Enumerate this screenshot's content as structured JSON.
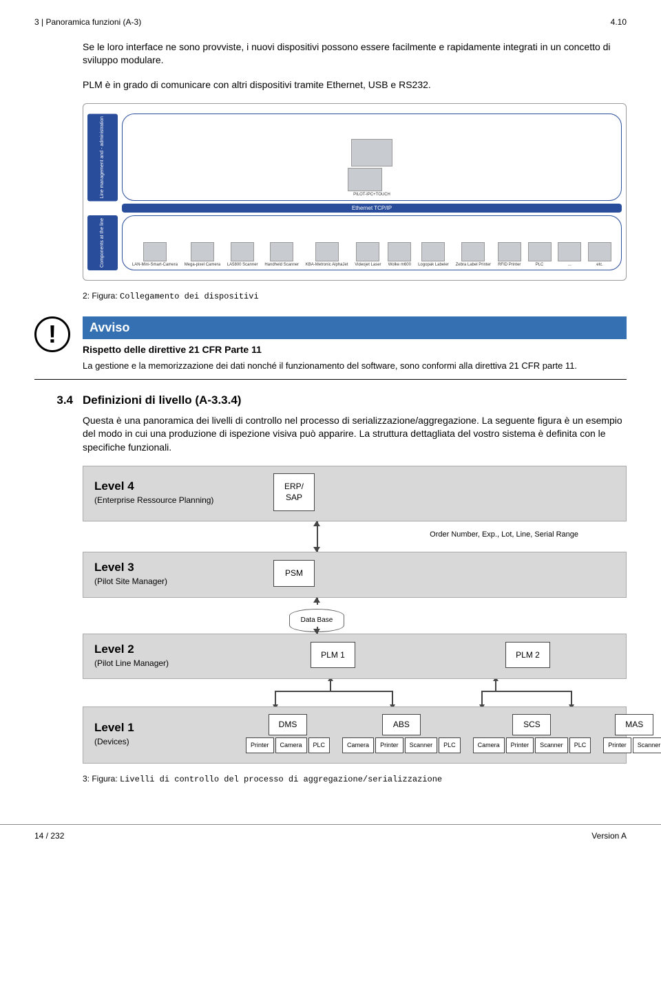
{
  "header": {
    "left": "3 | Panoramica funzioni (A-3)",
    "right": "4.10"
  },
  "intro": {
    "p1": "Se le loro interface ne sono provviste, i nuovi dispositivi possono essere facilmente e rapidamente integrati in un concetto di sviluppo modulare.",
    "p2": "PLM è in grado di comunicare con altri dispositivi tramite Ethernet, USB e RS232."
  },
  "fig1": {
    "side_labels": {
      "top": "Line management and - administration",
      "bottom": "Components at the line"
    },
    "top_item": "PILOT-IPC+TOUCH",
    "bus_label": "Ethernet TCP/IP",
    "items": [
      "LAN-Mini-Smart-Camera",
      "Mega-pixel Camera",
      "LA5800 Scanner",
      "Handheld Scanner",
      "KBA-Metronic AlphaJet",
      "Videojet Laser",
      "Wolke m600",
      "Logopak Labeler",
      "Zebra Label Printer",
      "RFID Printer",
      "PLC",
      "...",
      "etc."
    ],
    "caption_prefix": "2: Figura: ",
    "caption_mono": "Collegamento dei dispositivi"
  },
  "notice": {
    "title": "Avviso",
    "subtitle": "Rispetto delle direttive 21 CFR Parte 11",
    "text": "La gestione e la memorizzazione dei dati nonché il funzionamento del software, sono conformi alla direttiva 21 CFR parte 11."
  },
  "section": {
    "num": "3.4",
    "title": "Definizioni di livello (A-3.3.4)",
    "body": "Questa è una panoramica dei livelli di controllo nel processo di serializzazione/aggregazione. La seguente figura è un esempio del modo in cui una produzione di ispezione visiva può apparire. La struttura dettagliata del vostro sistema è definita con le specifiche funzionali."
  },
  "diagram": {
    "levels": [
      {
        "title": "Level 4",
        "sub": "(Enterprise Ressource Planning)",
        "boxes": [
          "ERP/\nSAP"
        ]
      },
      {
        "title": "Level 3",
        "sub": "(Pilot Site Manager)",
        "boxes": [
          "PSM"
        ]
      },
      {
        "title": "Level 2",
        "sub": "(Pilot Line Manager)",
        "boxes": [
          "PLM 1",
          "PLM 2"
        ]
      },
      {
        "title": "Level 1",
        "sub": "(Devices)"
      }
    ],
    "conn34_label": "Order Number, Exp., Lot, Line, Serial Range",
    "database_label": "Data Base",
    "devices": [
      {
        "main": "DMS",
        "subs": [
          "Printer",
          "Camera",
          "PLC"
        ]
      },
      {
        "main": "ABS",
        "subs": [
          "Camera",
          "Printer",
          "Scanner",
          "PLC"
        ]
      },
      {
        "main": "SCS",
        "subs": [
          "Camera",
          "Printer",
          "Scanner",
          "PLC"
        ]
      },
      {
        "main": "MAS",
        "subs": [
          "Printer",
          "Scanner"
        ]
      }
    ]
  },
  "fig2_caption": {
    "prefix": "3: Figura: ",
    "mono": "Livelli di controllo del processo di aggregazione/serializzazione"
  },
  "footer": {
    "left": "14 / 232",
    "right": "Version A"
  }
}
